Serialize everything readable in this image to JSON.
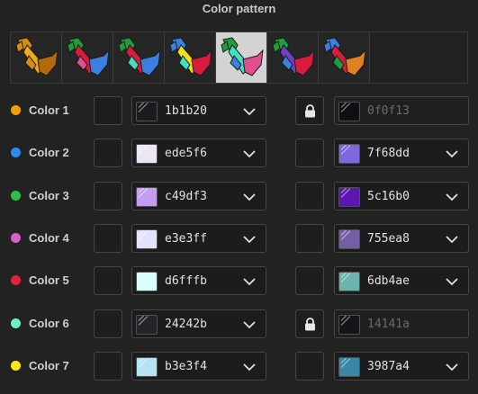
{
  "title": "Color pattern",
  "patterns": [
    {
      "name": "pattern-1",
      "selected": false,
      "colors": [
        "#d98c12",
        "#f0a81c",
        "#b36a0a"
      ]
    },
    {
      "name": "pattern-2",
      "selected": false,
      "colors": [
        "#1e9e3a",
        "#d91c3c",
        "#3b7fe0",
        "#e05090"
      ]
    },
    {
      "name": "pattern-3",
      "selected": false,
      "colors": [
        "#1e9e3a",
        "#d91c3c",
        "#3b7fe0",
        "#40e0c0"
      ]
    },
    {
      "name": "pattern-4",
      "selected": false,
      "colors": [
        "#3b7fe0",
        "#f0e020",
        "#d91c3c",
        "#40e0c0"
      ]
    },
    {
      "name": "pattern-5",
      "selected": true,
      "colors": [
        "#1e9e3a",
        "#40e0c0",
        "#e05090",
        "#3b7fe0"
      ]
    },
    {
      "name": "pattern-6",
      "selected": false,
      "colors": [
        "#1e9e3a",
        "#7040c0",
        "#d91c3c",
        "#3b7fe0"
      ]
    },
    {
      "name": "pattern-7",
      "selected": false,
      "colors": [
        "#3b7fe0",
        "#d91c3c",
        "#e08020",
        "#1e9e3a"
      ]
    }
  ],
  "rows": [
    {
      "label": "Color 1",
      "dot": "#f0a000",
      "left_hex": "1b1b20",
      "left_color": "#1b1b20",
      "right_hex": "0f0f13",
      "right_color": "#0f0f13",
      "right_locked": true
    },
    {
      "label": "Color 2",
      "dot": "#2a8cf0",
      "left_hex": "ede5f6",
      "left_color": "#ede5f6",
      "right_hex": "7f68dd",
      "right_color": "#7f68dd",
      "right_locked": false
    },
    {
      "label": "Color 3",
      "dot": "#2ec04a",
      "left_hex": "c49df3",
      "left_color": "#c49df3",
      "right_hex": "5c16b0",
      "right_color": "#5c16b0",
      "right_locked": false
    },
    {
      "label": "Color 4",
      "dot": "#d860c8",
      "left_hex": "e3e3ff",
      "left_color": "#e3e3ff",
      "right_hex": "755ea8",
      "right_color": "#755ea8",
      "right_locked": false
    },
    {
      "label": "Color 5",
      "dot": "#e0203c",
      "left_hex": "d6fffb",
      "left_color": "#d6fffb",
      "right_hex": "6db4ae",
      "right_color": "#6db4ae",
      "right_locked": false
    },
    {
      "label": "Color 6",
      "dot": "#6ef0c8",
      "left_hex": "24242b",
      "left_color": "#24242b",
      "right_hex": "14141a",
      "right_color": "#14141a",
      "right_locked": true
    },
    {
      "label": "Color 7",
      "dot": "#f8e818",
      "left_hex": "b3e3f4",
      "left_color": "#b3e3f4",
      "right_hex": "3987a4",
      "right_color": "#3987a4",
      "right_locked": false
    }
  ],
  "icons": {
    "lock": "lock-icon",
    "chevron": "chevron-down-icon"
  }
}
